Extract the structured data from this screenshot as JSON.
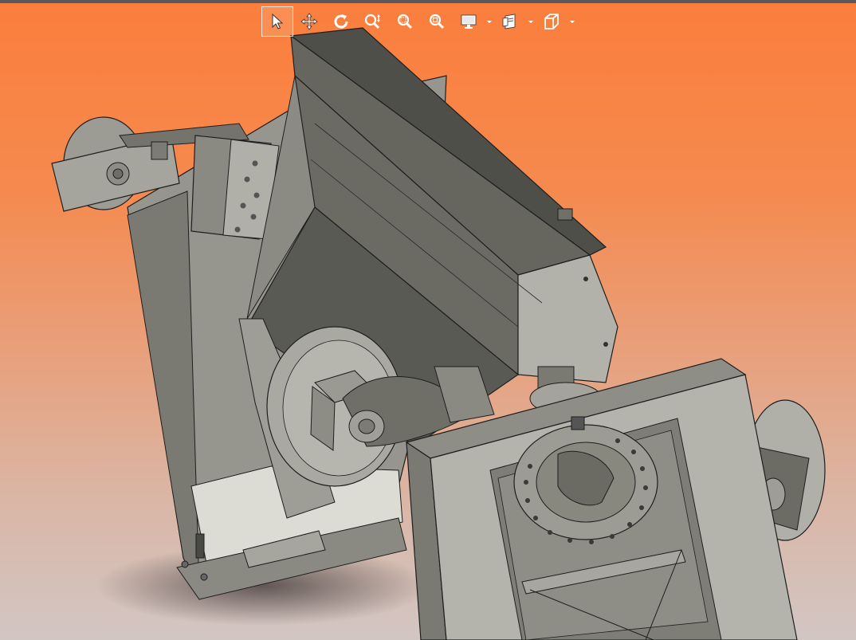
{
  "window": {
    "title": ""
  },
  "colors": {
    "background_top": "#fb7e3c",
    "background_bottom": "#d2c6c3",
    "part_dark": "#5c5c56",
    "part_mid": "#8c8c84",
    "part_light": "#b3b3ab",
    "edge": "#1e1e1e"
  },
  "toolbar": {
    "items": [
      {
        "id": "select",
        "icon": "select-arrow-icon",
        "active": true
      },
      {
        "id": "pan",
        "icon": "pan-move-icon",
        "active": false
      },
      {
        "id": "rotate",
        "icon": "rotate-icon",
        "active": false
      },
      {
        "id": "zoom-in-out",
        "icon": "zoom-in-out-icon",
        "active": false
      },
      {
        "id": "zoom-to-area",
        "icon": "zoom-to-area-icon",
        "active": false
      },
      {
        "id": "zoom-to-fit",
        "icon": "zoom-to-fit-icon",
        "active": false
      },
      {
        "id": "display-mode",
        "icon": "display-monitor-icon",
        "active": false,
        "dropdown": true
      },
      {
        "id": "view-settings",
        "icon": "view-settings-icon",
        "active": false,
        "dropdown": true
      },
      {
        "id": "standard-views",
        "icon": "standard-views-cube-icon",
        "active": false,
        "dropdown": true
      }
    ]
  },
  "model": {
    "name": ""
  }
}
